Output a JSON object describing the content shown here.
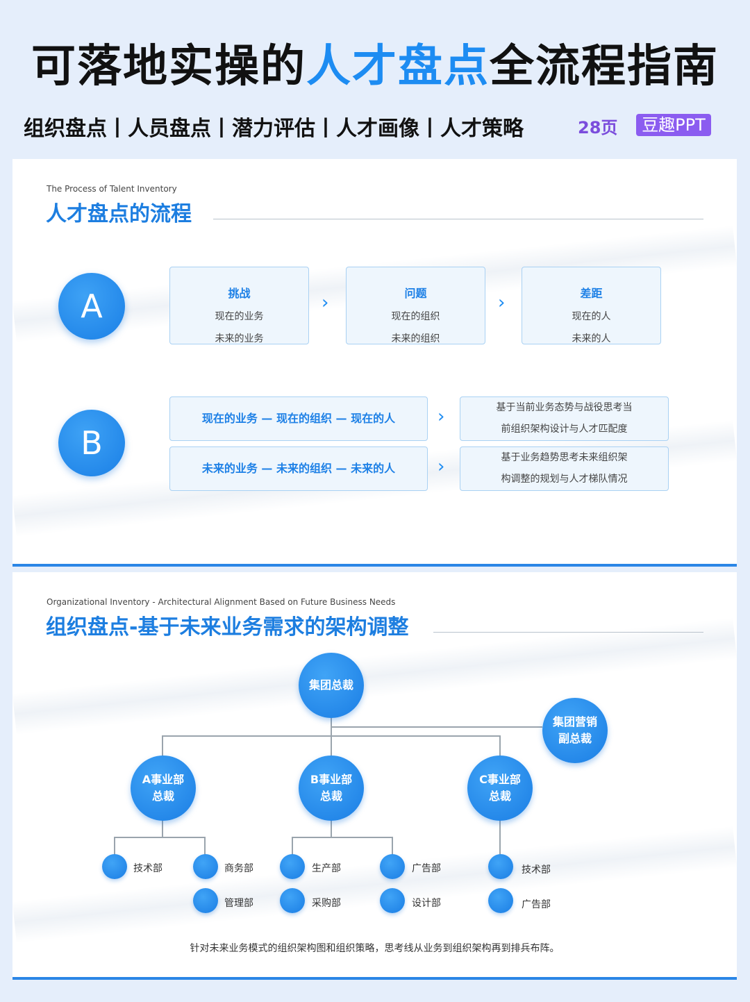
{
  "header": {
    "title_pre": "可落地实操的",
    "title_highlight": "人才盘点",
    "title_post": "全流程指南",
    "subtitle": "组织盘点丨人员盘点丨潜力评估丨人才画像丨人才策略",
    "pages": "28页",
    "brand": "豆趣PPT"
  },
  "section1": {
    "en": "The Process of Talent Inventory",
    "title": "人才盘点的流程",
    "row_a": {
      "label": "A",
      "boxes": [
        {
          "title": "挑战",
          "line1": "现在的业务",
          "line2": "未来的业务"
        },
        {
          "title": "问题",
          "line1": "现在的组织",
          "line2": "未来的组织"
        },
        {
          "title": "差距",
          "line1": "现在的人",
          "line2": "未来的人"
        }
      ]
    },
    "row_b": {
      "label": "B",
      "chains": [
        "现在的业务 — 现在的组织 — 现在的人",
        "未来的业务 — 未来的组织 — 未来的人"
      ],
      "descs": [
        {
          "line1": "基于当前业务态势与战役思考当",
          "line2": "前组织架构设计与人才匹配度"
        },
        {
          "line1": "基于业务趋势思考未来组织架",
          "line2": "构调整的规划与人才梯队情况"
        }
      ]
    },
    "chevron": "›"
  },
  "section2": {
    "en": "Organizational Inventory - Architectural Alignment Based on Future Business Needs",
    "title": "组织盘点-基于未来业务需求的架构调整",
    "root": "集团总裁",
    "vp": {
      "line1": "集团营销",
      "line2": "副总裁"
    },
    "units": [
      {
        "line1": "A事业部",
        "line2": "总裁"
      },
      {
        "line1": "B事业部",
        "line2": "总裁"
      },
      {
        "line1": "C事业部",
        "line2": "总裁"
      }
    ],
    "depts": [
      "技术部",
      "商务部",
      "管理部",
      "生产部",
      "采购部",
      "广告部",
      "设计部",
      "技术部",
      "广告部"
    ],
    "caption": "针对未来业务模式的组织架构图和组织策略，思考线从业务到组织架构再到排兵布阵。"
  }
}
